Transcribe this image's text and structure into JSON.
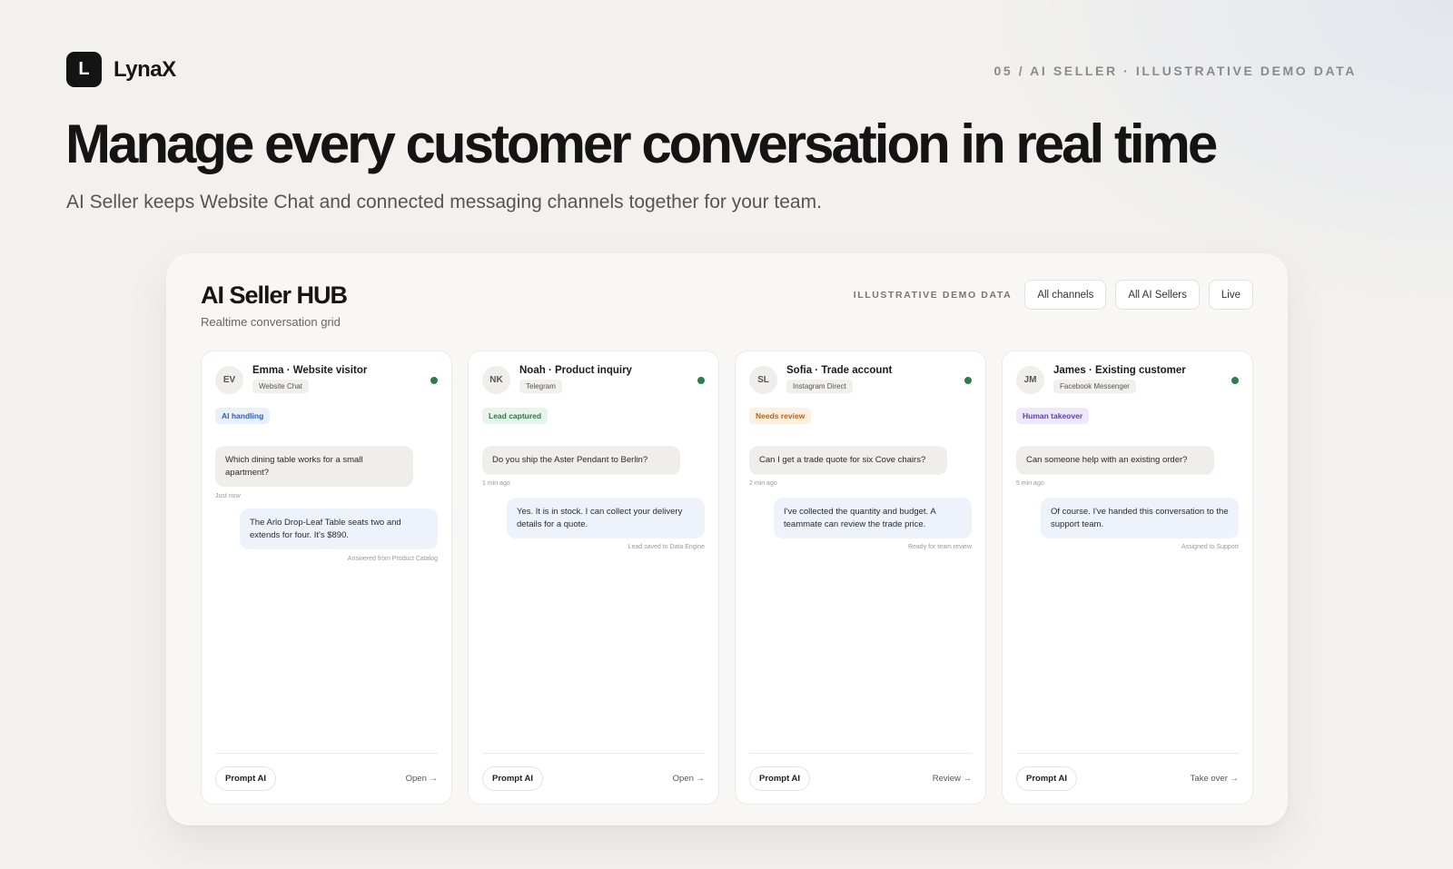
{
  "brand": {
    "mark": "L",
    "name": "LynaX"
  },
  "section_tag": "05 / AI SELLER · ILLUSTRATIVE DEMO DATA",
  "hero": {
    "title": "Manage every customer conversation in real time",
    "subtitle": "AI Seller keeps Website Chat and connected messaging channels together for your team."
  },
  "hub": {
    "title": "AI Seller HUB",
    "subtitle": "Realtime conversation grid",
    "demo_label": "ILLUSTRATIVE DEMO DATA",
    "filters": {
      "channels": "All channels",
      "sellers": "All AI Sellers",
      "live": "Live"
    }
  },
  "colors": {
    "online": "#2e7d4f",
    "badge_ai": {
      "bg": "#e8f0fc",
      "fg": "#2f5fb3"
    },
    "badge_lead": {
      "bg": "#e6f4ea",
      "fg": "#2d7a45"
    },
    "badge_review": {
      "bg": "#fdf0e0",
      "fg": "#b0651c"
    },
    "badge_human": {
      "bg": "#eee8fb",
      "fg": "#5a3fb0"
    }
  },
  "cards": [
    {
      "initials": "EV",
      "name": "Emma · Website visitor",
      "channel": "Website Chat",
      "status": "AI handling",
      "incoming": "Which dining table works for a small apartment?",
      "time": "Just now",
      "reply": "The Arlo Drop-Leaf Table seats two and extends for four. It's $890.",
      "note": "Answered from Product Catalog",
      "prompt": "Prompt AI",
      "action": "Open →"
    },
    {
      "initials": "NK",
      "name": "Noah · Product inquiry",
      "channel": "Telegram",
      "status": "Lead captured",
      "incoming": "Do you ship the Aster Pendant to Berlin?",
      "time": "1 min ago",
      "reply": "Yes. It is in stock. I can collect your delivery details for a quote.",
      "note": "Lead saved to Data Engine",
      "prompt": "Prompt AI",
      "action": "Open →"
    },
    {
      "initials": "SL",
      "name": "Sofia · Trade account",
      "channel": "Instagram Direct",
      "status": "Needs review",
      "incoming": "Can I get a trade quote for six Cove chairs?",
      "time": "2 min ago",
      "reply": "I've collected the quantity and budget. A teammate can review the trade price.",
      "note": "Ready for team review",
      "prompt": "Prompt AI",
      "action": "Review →"
    },
    {
      "initials": "JM",
      "name": "James · Existing customer",
      "channel": "Facebook Messenger",
      "status": "Human takeover",
      "incoming": "Can someone help with an existing order?",
      "time": "5 min ago",
      "reply": "Of course. I've handed this conversation to the support team.",
      "note": "Assigned to Support",
      "prompt": "Prompt AI",
      "action": "Take over →"
    }
  ]
}
